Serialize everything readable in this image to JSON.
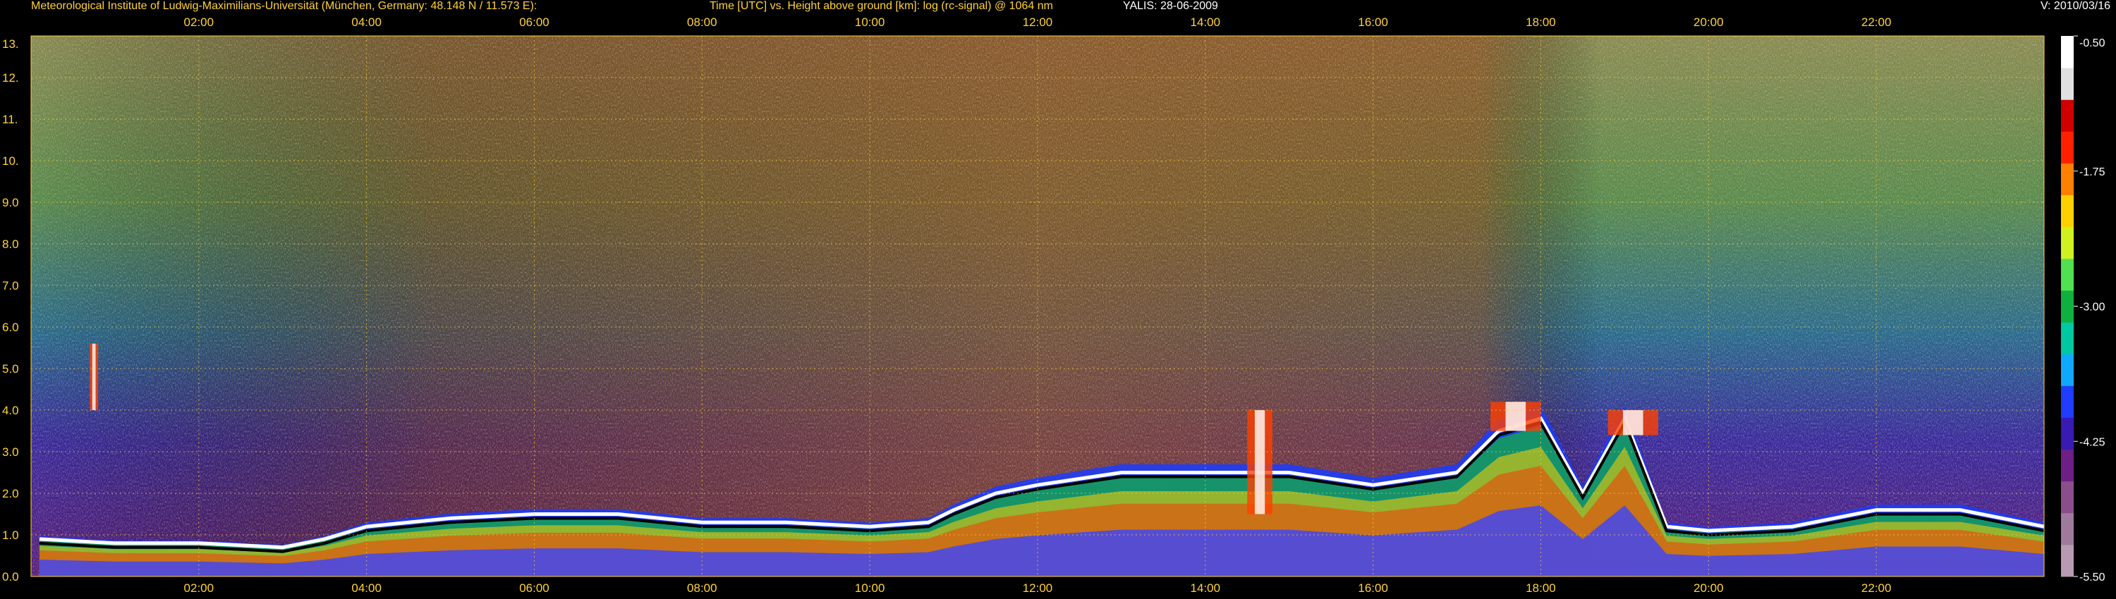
{
  "header": {
    "institute": "Meteorological Institute of Ludwig-Maximilians-Universität (München, Germany: 48.148 N / 11.573 E):",
    "plot_title": "Time [UTC] vs. Height above ground [km]: log (rc-signal) @ 1064 nm",
    "station": "YALIS: 28-06-2009",
    "version": "V: 2010/03/16"
  },
  "chart_data": {
    "type": "heatmap",
    "title": "Time [UTC] vs. Height above ground [km]: log (rc-signal) @ 1064 nm",
    "x_ticks": [
      "02:00",
      "04:00",
      "06:00",
      "08:00",
      "10:00",
      "12:00",
      "14:00",
      "16:00",
      "18:00",
      "20:00",
      "22:00"
    ],
    "x_tick_hours": [
      2,
      4,
      6,
      8,
      10,
      12,
      14,
      16,
      18,
      20,
      22
    ],
    "xlim_hours": [
      0,
      24
    ],
    "y_ticks": [
      "0.0",
      "1.0",
      "2.0",
      "3.0",
      "4.0",
      "5.0",
      "6.0",
      "7.0",
      "8.0",
      "9.0",
      "10.",
      "11.",
      "12.",
      "13."
    ],
    "ylim_km": [
      0,
      13
    ],
    "grid": true,
    "colorbar": {
      "ticks": [
        "-0.50",
        "-1.75",
        "-3.00",
        "-4.25",
        "-5.50"
      ],
      "range": [
        -5.5,
        -0.5
      ],
      "colors": [
        "#b89bb3",
        "#a07a9c",
        "#8a4f8a",
        "#6d1f86",
        "#3a1ab5",
        "#1f3cff",
        "#10a8ff",
        "#00c8a0",
        "#10b040",
        "#50e050",
        "#d0f020",
        "#ffd000",
        "#ff8000",
        "#ff2000",
        "#d00000",
        "#e0e0e0",
        "#ffffff"
      ]
    },
    "boundary_layer_top_km": [
      [
        0.1,
        0.9
      ],
      [
        1,
        0.8
      ],
      [
        2,
        0.8
      ],
      [
        3,
        0.7
      ],
      [
        3.5,
        0.9
      ],
      [
        4,
        1.2
      ],
      [
        5,
        1.4
      ],
      [
        6,
        1.5
      ],
      [
        7,
        1.5
      ],
      [
        8,
        1.3
      ],
      [
        9,
        1.3
      ],
      [
        10,
        1.2
      ],
      [
        10.7,
        1.3
      ],
      [
        11,
        1.6
      ],
      [
        11.5,
        2.0
      ],
      [
        12,
        2.2
      ],
      [
        13,
        2.5
      ],
      [
        14,
        2.5
      ],
      [
        15,
        2.5
      ],
      [
        16,
        2.2
      ],
      [
        17,
        2.5
      ],
      [
        17.5,
        3.5
      ],
      [
        18,
        3.8
      ],
      [
        18.5,
        2.0
      ],
      [
        19,
        3.8
      ],
      [
        19.5,
        1.2
      ],
      [
        20,
        1.1
      ],
      [
        21,
        1.2
      ],
      [
        22,
        1.6
      ],
      [
        23,
        1.6
      ],
      [
        24,
        1.2
      ]
    ],
    "elevated_layers": [
      {
        "start_h": 0.7,
        "end_h": 0.8,
        "base_km": 4.0,
        "top_km": 5.6
      },
      {
        "start_h": 14.5,
        "end_h": 14.8,
        "base_km": 1.5,
        "top_km": 4.0
      },
      {
        "start_h": 17.4,
        "end_h": 18.0,
        "base_km": 3.5,
        "top_km": 4.2
      },
      {
        "start_h": 18.8,
        "end_h": 19.4,
        "base_km": 3.4,
        "top_km": 4.0
      }
    ]
  }
}
